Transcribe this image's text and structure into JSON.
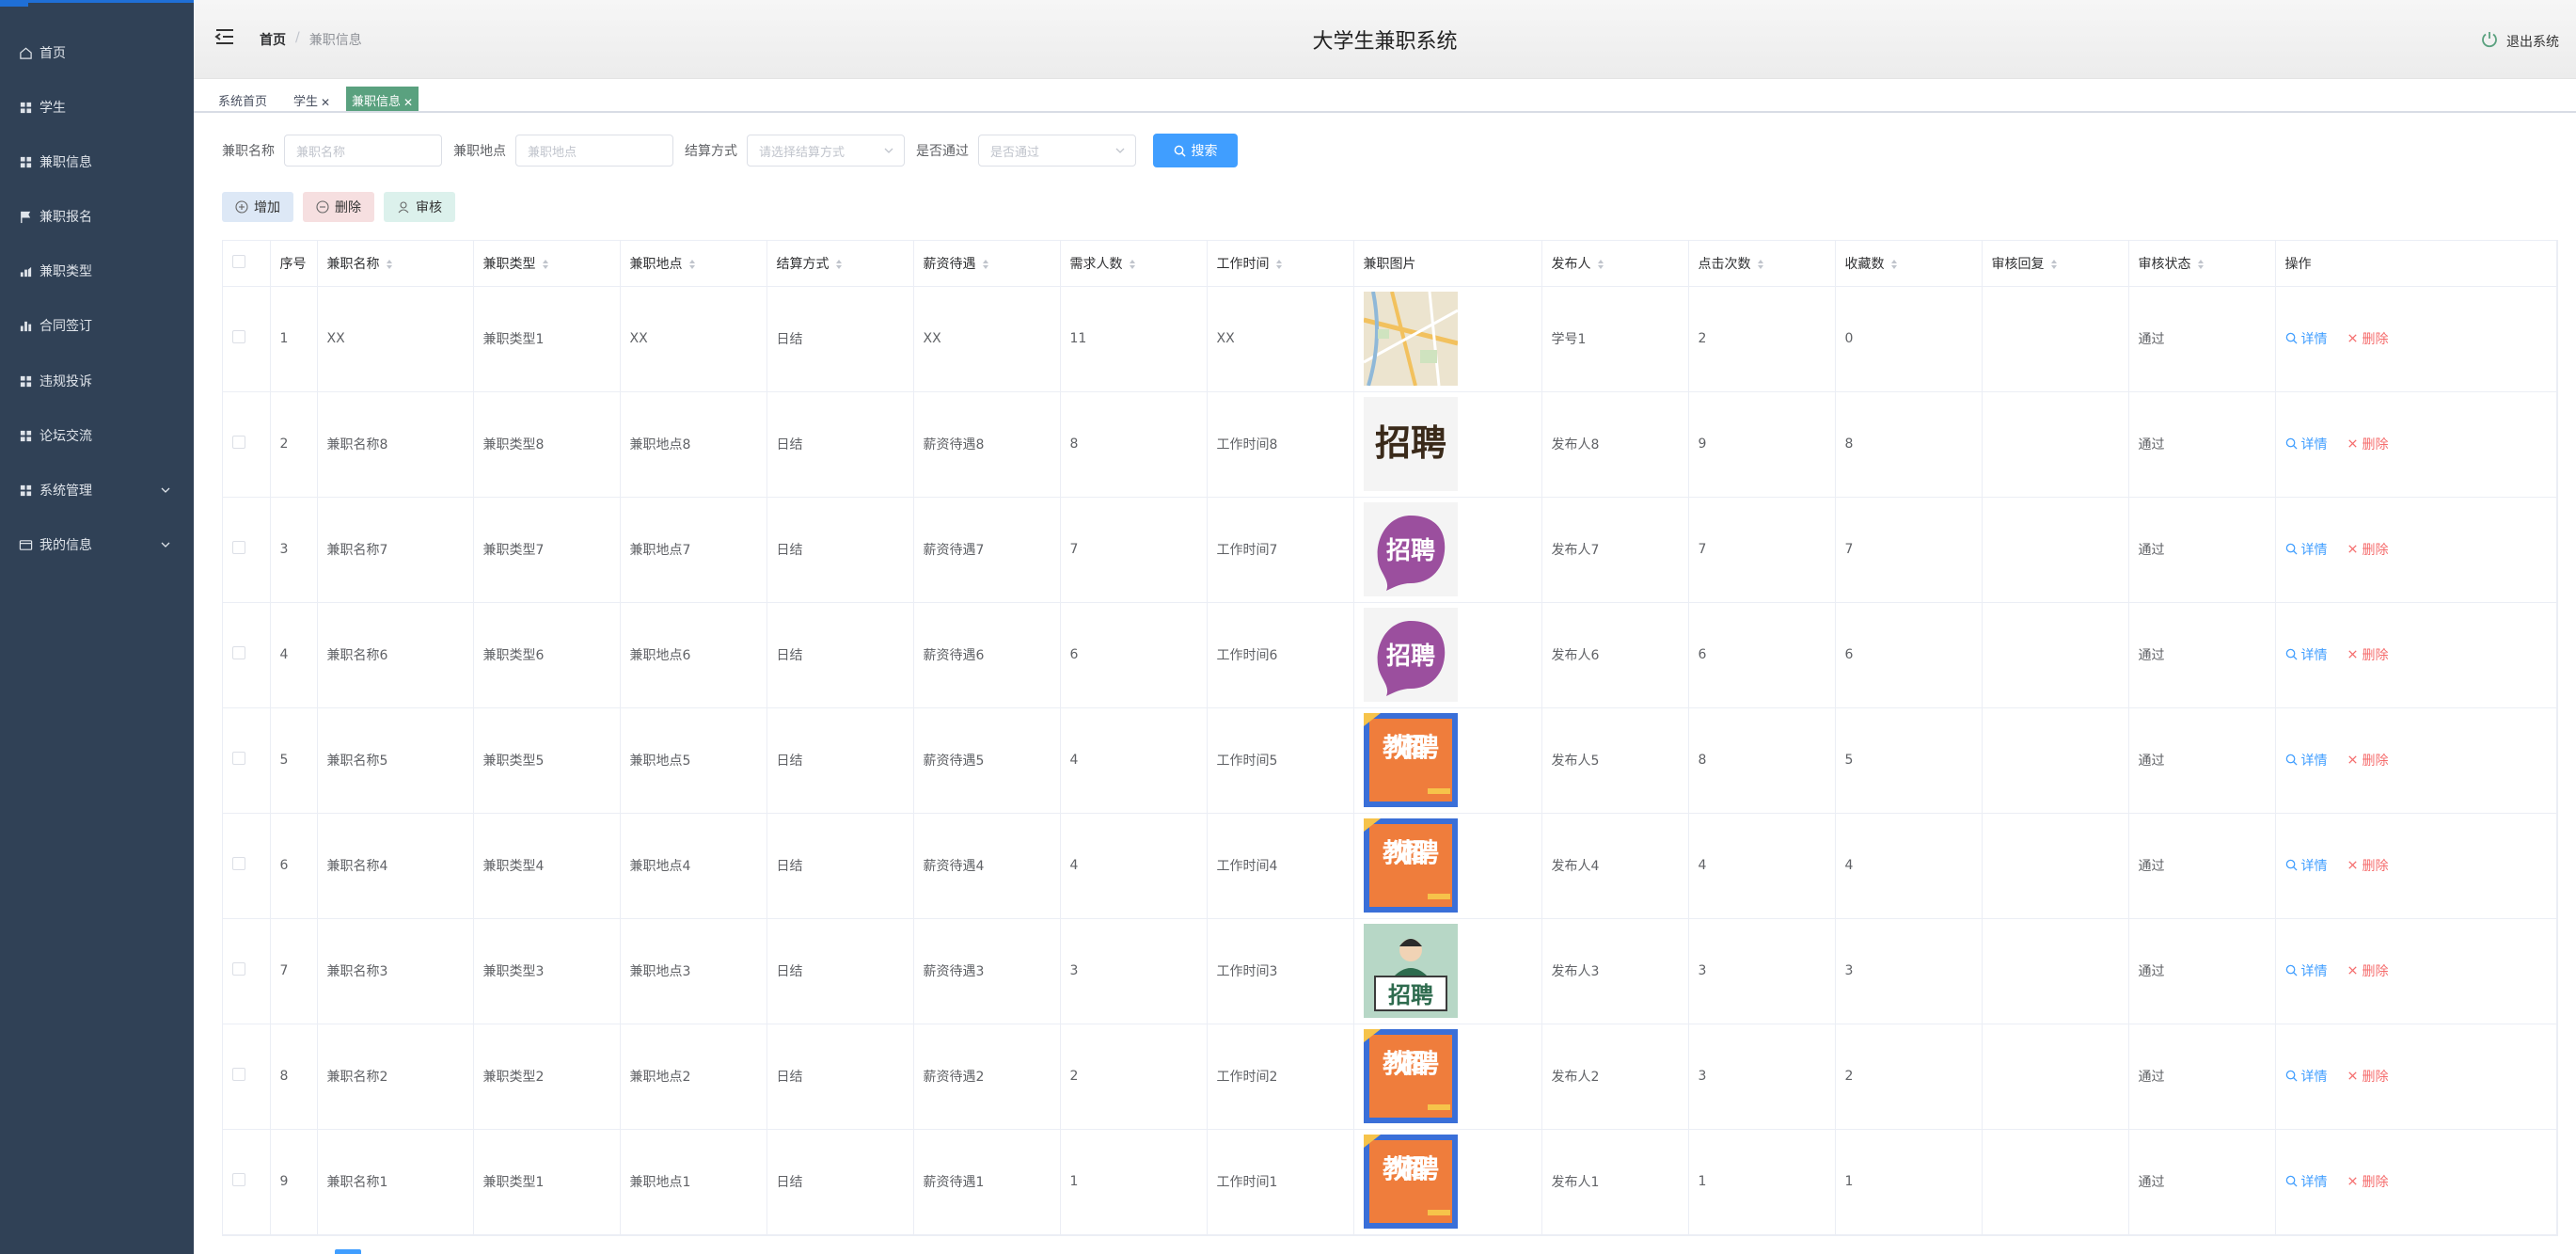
{
  "sidebar": {
    "items": [
      {
        "label": "首页",
        "icon": "home-icon"
      },
      {
        "label": "学生",
        "icon": "grid-icon"
      },
      {
        "label": "兼职信息",
        "icon": "grid-icon"
      },
      {
        "label": "兼职报名",
        "icon": "flag-icon"
      },
      {
        "label": "兼职类型",
        "icon": "chart-icon"
      },
      {
        "label": "合同签订",
        "icon": "bar-chart-icon"
      },
      {
        "label": "违规投诉",
        "icon": "grid-icon"
      },
      {
        "label": "论坛交流",
        "icon": "grid-icon"
      },
      {
        "label": "系统管理",
        "icon": "grid-icon",
        "expandable": true
      },
      {
        "label": "我的信息",
        "icon": "card-icon",
        "expandable": true
      }
    ]
  },
  "header": {
    "breadcrumb_home": "首页",
    "breadcrumb_sep": "/",
    "breadcrumb_current": "兼职信息",
    "title": "大学生兼职系统",
    "logout": "退出系统"
  },
  "tags": [
    {
      "label": "系统首页",
      "closable": false
    },
    {
      "label": "学生",
      "closable": true
    },
    {
      "label": "兼职信息",
      "closable": true,
      "active": true
    }
  ],
  "filters": {
    "name_label": "兼职名称",
    "name_placeholder": "兼职名称",
    "place_label": "兼职地点",
    "place_placeholder": "兼职地点",
    "settle_label": "结算方式",
    "settle_placeholder": "请选择结算方式",
    "pass_label": "是否通过",
    "pass_placeholder": "是否通过",
    "search": "搜索"
  },
  "actions": {
    "add": "增加",
    "delete": "删除",
    "audit": "审核"
  },
  "table": {
    "columns": [
      "序号",
      "兼职名称",
      "兼职类型",
      "兼职地点",
      "结算方式",
      "薪资待遇",
      "需求人数",
      "工作时间",
      "兼职图片",
      "发布人",
      "点击次数",
      "收藏数",
      "审核回复",
      "审核状态",
      "操作"
    ],
    "detail_label": "详情",
    "delete_label": "删除",
    "rows": [
      {
        "no": "1",
        "name": "XX",
        "type": "兼职类型1",
        "place": "XX",
        "settle": "日结",
        "salary": "XX",
        "need": "11",
        "time": "XX",
        "img": "map",
        "img_text": "",
        "publisher": "学号1",
        "clicks": "2",
        "favs": "0",
        "reply": "",
        "status": "通过"
      },
      {
        "no": "2",
        "name": "兼职名称8",
        "type": "兼职类型8",
        "place": "兼职地点8",
        "settle": "日结",
        "salary": "薪资待遇8",
        "need": "8",
        "time": "工作时间8",
        "img": "zhaopin-brown",
        "img_text": "招聘",
        "publisher": "发布人8",
        "clicks": "9",
        "favs": "8",
        "reply": "",
        "status": "通过"
      },
      {
        "no": "3",
        "name": "兼职名称7",
        "type": "兼职类型7",
        "place": "兼职地点7",
        "settle": "日结",
        "salary": "薪资待遇7",
        "need": "7",
        "time": "工作时间7",
        "img": "zhaopin-purple",
        "img_text": "招聘",
        "publisher": "发布人7",
        "clicks": "7",
        "favs": "7",
        "reply": "",
        "status": "通过"
      },
      {
        "no": "4",
        "name": "兼职名称6",
        "type": "兼职类型6",
        "place": "兼职地点6",
        "settle": "日结",
        "salary": "薪资待遇6",
        "need": "6",
        "time": "工作时间6",
        "img": "zhaopin-purple",
        "img_text": "招聘",
        "publisher": "发布人6",
        "clicks": "6",
        "favs": "6",
        "reply": "",
        "status": "通过"
      },
      {
        "no": "5",
        "name": "兼职名称5",
        "type": "兼职类型5",
        "place": "兼职地点5",
        "settle": "日结",
        "salary": "薪资待遇5",
        "need": "4",
        "time": "工作时间5",
        "img": "teacher",
        "img_text": "教师招聘",
        "publisher": "发布人5",
        "clicks": "8",
        "favs": "5",
        "reply": "",
        "status": "通过"
      },
      {
        "no": "6",
        "name": "兼职名称4",
        "type": "兼职类型4",
        "place": "兼职地点4",
        "settle": "日结",
        "salary": "薪资待遇4",
        "need": "4",
        "time": "工作时间4",
        "img": "teacher",
        "img_text": "教师招聘",
        "publisher": "发布人4",
        "clicks": "4",
        "favs": "4",
        "reply": "",
        "status": "通过"
      },
      {
        "no": "7",
        "name": "兼职名称3",
        "type": "兼职类型3",
        "place": "兼职地点3",
        "settle": "日结",
        "salary": "薪资待遇3",
        "need": "3",
        "time": "工作时间3",
        "img": "person",
        "img_text": "招聘",
        "publisher": "发布人3",
        "clicks": "3",
        "favs": "3",
        "reply": "",
        "status": "通过"
      },
      {
        "no": "8",
        "name": "兼职名称2",
        "type": "兼职类型2",
        "place": "兼职地点2",
        "settle": "日结",
        "salary": "薪资待遇2",
        "need": "2",
        "time": "工作时间2",
        "img": "teacher",
        "img_text": "教师招聘",
        "publisher": "发布人2",
        "clicks": "3",
        "favs": "2",
        "reply": "",
        "status": "通过"
      },
      {
        "no": "9",
        "name": "兼职名称1",
        "type": "兼职类型1",
        "place": "兼职地点1",
        "settle": "日结",
        "salary": "薪资待遇1",
        "need": "1",
        "time": "工作时间1",
        "img": "teacher",
        "img_text": "教师招聘",
        "publisher": "发布人1",
        "clicks": "1",
        "favs": "1",
        "reply": "",
        "status": "通过"
      }
    ]
  },
  "colors": {
    "sidebar": "#304156",
    "primary": "#409eff",
    "danger": "#f56c6c",
    "active_tag": "#5aa17f"
  }
}
